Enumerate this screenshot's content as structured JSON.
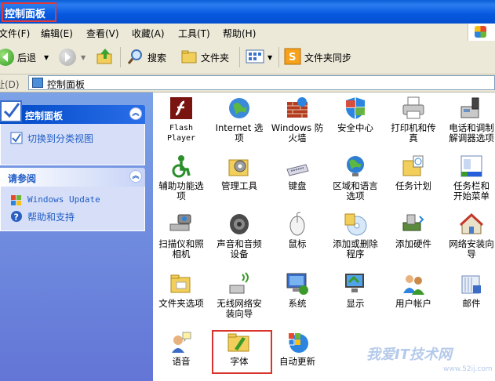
{
  "window": {
    "title": "控制面板"
  },
  "menu": [
    "文件(F)",
    "编辑(E)",
    "查看(V)",
    "收藏(A)",
    "工具(T)",
    "帮助(H)"
  ],
  "toolbar": {
    "back": "后退",
    "search": "搜索",
    "folders": "文件夹",
    "sync": "文件夹同步"
  },
  "address": {
    "label": "地址(D)",
    "value": "控制面板"
  },
  "sidebar": {
    "cp_panel": {
      "title": "控制面板",
      "task": "切换到分类视图"
    },
    "see_also": {
      "title": "请参阅",
      "items": [
        "Windows Update",
        "帮助和支持"
      ]
    }
  },
  "items": [
    {
      "label": "Flash\nPlayer",
      "icon": "flash-icon"
    },
    {
      "label": "Internet 选\n项",
      "icon": "globe-icon"
    },
    {
      "label": "Windows 防\n火墙",
      "icon": "firewall-icon"
    },
    {
      "label": "安全中心",
      "icon": "shield-icon"
    },
    {
      "label": "打印机和传\n真",
      "icon": "printer-icon"
    },
    {
      "label": "电话和调制\n解调器选项",
      "icon": "phone-icon"
    },
    {
      "label": "辅助功能选\n项",
      "icon": "accessibility-icon"
    },
    {
      "label": "管理工具",
      "icon": "admin-tools-icon"
    },
    {
      "label": "键盘",
      "icon": "keyboard-icon"
    },
    {
      "label": "区域和语言\n选项",
      "icon": "region-globe-icon"
    },
    {
      "label": "任务计划",
      "icon": "task-folder-icon"
    },
    {
      "label": "任务栏和\n开始菜单",
      "icon": "taskbar-icon"
    },
    {
      "label": "扫描仪和照\n相机",
      "icon": "scanner-icon"
    },
    {
      "label": "声音和音频\n设备",
      "icon": "speaker-icon"
    },
    {
      "label": "鼠标",
      "icon": "mouse-icon"
    },
    {
      "label": "添加或删除\n程序",
      "icon": "add-remove-icon"
    },
    {
      "label": "添加硬件",
      "icon": "hardware-icon"
    },
    {
      "label": "网络安装向\n导",
      "icon": "network-home-icon"
    },
    {
      "label": "文件夹选项",
      "icon": "folder-options-icon"
    },
    {
      "label": "无线网络安\n装向导",
      "icon": "wireless-icon"
    },
    {
      "label": "系统",
      "icon": "system-icon"
    },
    {
      "label": "显示",
      "icon": "display-icon"
    },
    {
      "label": "用户帐户",
      "icon": "users-icon"
    },
    {
      "label": "邮件",
      "icon": "mail-icon"
    },
    {
      "label": "语音",
      "icon": "speech-icon"
    },
    {
      "label": "字体",
      "icon": "fonts-folder-icon"
    },
    {
      "label": "自动更新",
      "icon": "windows-update-icon"
    }
  ],
  "watermark": {
    "text": "我爱IT技术网",
    "url": "www.52ij.com"
  },
  "colors": {
    "title_bar": "#0758e0",
    "sidebar": "#6375d6",
    "link": "#215dc6",
    "highlight": "#d9342b"
  }
}
